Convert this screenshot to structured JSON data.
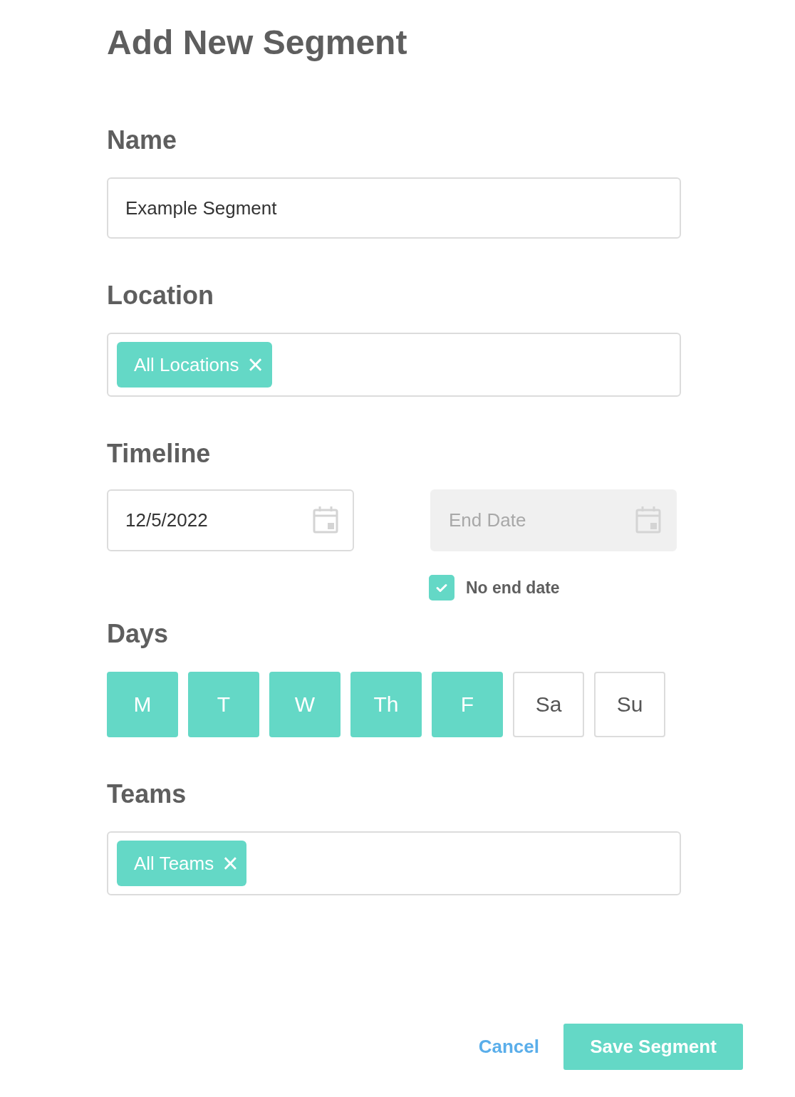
{
  "title": "Add New Segment",
  "name": {
    "label": "Name",
    "value": "Example Segment"
  },
  "location": {
    "label": "Location",
    "chips": [
      "All Locations"
    ],
    "remove_glyph": "×"
  },
  "timeline": {
    "label": "Timeline",
    "start": {
      "value": "12/5/2022",
      "disabled": false
    },
    "end": {
      "placeholder": "End Date",
      "disabled": true
    },
    "no_end_date": {
      "label": "No end date",
      "checked": true
    }
  },
  "days": {
    "label": "Days",
    "items": [
      {
        "label": "M",
        "selected": true
      },
      {
        "label": "T",
        "selected": true
      },
      {
        "label": "W",
        "selected": true
      },
      {
        "label": "Th",
        "selected": true
      },
      {
        "label": "F",
        "selected": true
      },
      {
        "label": "Sa",
        "selected": false
      },
      {
        "label": "Su",
        "selected": false
      }
    ]
  },
  "teams": {
    "label": "Teams",
    "chips": [
      "All Teams"
    ],
    "remove_glyph": "×"
  },
  "buttons": {
    "cancel": "Cancel",
    "save": "Save Segment"
  }
}
